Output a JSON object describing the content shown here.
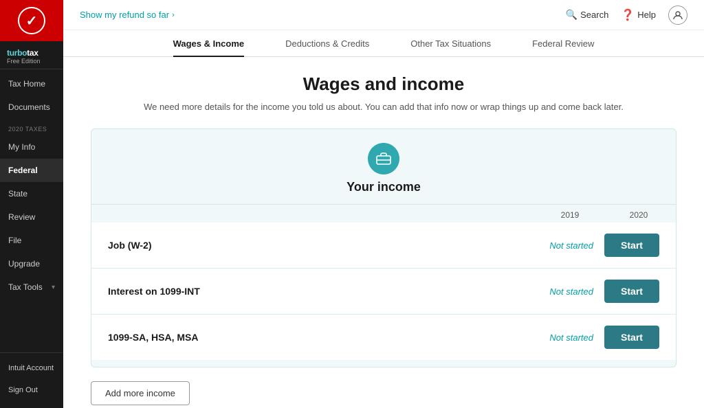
{
  "sidebar": {
    "logo_checkmark": "✓",
    "brand_name": "turbotax",
    "edition": "Free Edition",
    "tax_home_label": "Tax Home",
    "documents_label": "Documents",
    "section_label": "2020 TAXES",
    "my_info_label": "My Info",
    "federal_label": "Federal",
    "state_label": "State",
    "review_label": "Review",
    "file_label": "File",
    "upgrade_label": "Upgrade",
    "tax_tools_label": "Tax Tools",
    "intuit_account_label": "Intuit Account",
    "sign_out_label": "Sign Out"
  },
  "topbar": {
    "refund_link": "Show my refund so far",
    "search_label": "Search",
    "help_label": "Help"
  },
  "tabs": [
    {
      "id": "wages",
      "label": "Wages & Income",
      "active": true
    },
    {
      "id": "deductions",
      "label": "Deductions & Credits",
      "active": false
    },
    {
      "id": "other",
      "label": "Other Tax Situations",
      "active": false
    },
    {
      "id": "federal",
      "label": "Federal Review",
      "active": false
    }
  ],
  "page": {
    "title": "Wages and income",
    "subtitle": "We need more details for the income you told us about. You can add that info now or wrap things up and come back later."
  },
  "income_card": {
    "title": "Your income",
    "year_2019": "2019",
    "year_2020": "2020",
    "rows": [
      {
        "id": "job_w2",
        "label": "Job (W-2)",
        "status": "Not started",
        "button": "Start"
      },
      {
        "id": "interest_1099",
        "label": "Interest on 1099-INT",
        "status": "Not started",
        "button": "Start"
      },
      {
        "id": "1099_sa_hsa",
        "label": "1099-SA, HSA, MSA",
        "status": "Not started",
        "button": "Start"
      }
    ],
    "add_income_button": "Add more income"
  }
}
